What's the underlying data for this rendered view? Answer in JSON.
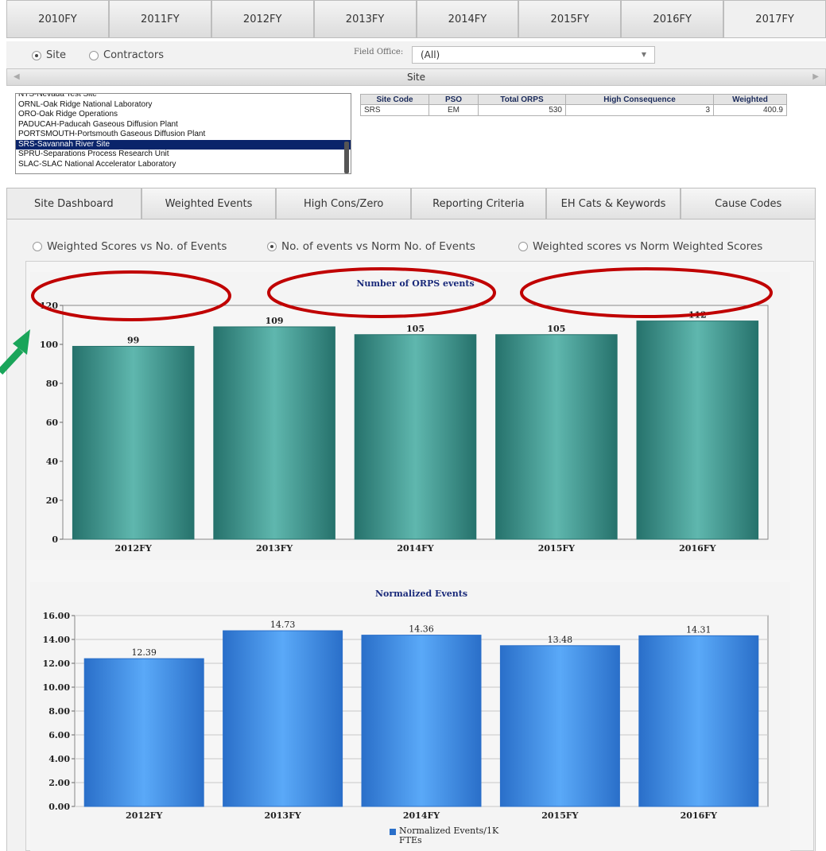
{
  "fy_tabs": [
    "2010FY",
    "2011FY",
    "2012FY",
    "2013FY",
    "2014FY",
    "2015FY",
    "2016FY",
    "2017FY"
  ],
  "filter": {
    "site_label": "Site",
    "contractors_label": "Contractors",
    "selected": "Site",
    "field_office_label": "Field Office:",
    "field_office_value": "(All)"
  },
  "site_bar_title": "Site",
  "site_list": [
    "NTS-Nevada Test Site",
    "ORNL-Oak Ridge National Laboratory",
    "ORO-Oak Ridge Operations",
    "PADUCAH-Paducah Gaseous Diffusion Plant",
    "PORTSMOUTH-Portsmouth Gaseous Diffusion Plant",
    "SRS-Savannah River Site",
    "SPRU-Separations Process Research Unit",
    "SLAC-SLAC National Accelerator Laboratory"
  ],
  "selected_site": "SRS-Savannah River Site",
  "summary": {
    "headers": [
      "Site Code",
      "PSO",
      "Total ORPS",
      "High Consequence",
      "Weighted"
    ],
    "row": [
      "SRS",
      "EM",
      "530",
      "3",
      "400.9"
    ]
  },
  "dash_tabs": [
    "Site Dashboard",
    "Weighted Events",
    "High Cons/Zero",
    "Reporting Criteria",
    "EH Cats & Keywords",
    "Cause Codes"
  ],
  "view_radios": {
    "options": [
      "Weighted Scores vs No. of Events",
      "No. of events vs Norm No. of Events",
      "Weighted scores vs Norm Weighted Scores"
    ],
    "selected": "No. of events vs Norm No. of Events"
  },
  "colors": {
    "teal_bar": "#2e8b85",
    "blue_bar": "#3d8ee6",
    "highlight_ellipse": "#c00000",
    "arrow": "#1aa55a",
    "selection": "#0a246a"
  },
  "chart_data": [
    {
      "type": "bar",
      "title": "Number of ORPS events",
      "categories": [
        "2012FY",
        "2013FY",
        "2014FY",
        "2015FY",
        "2016FY"
      ],
      "values": [
        99,
        109,
        105,
        105,
        112
      ],
      "value_labels": [
        "99",
        "109",
        "105",
        "105",
        "112"
      ],
      "ylim": [
        0,
        120
      ],
      "yticks": [
        "0",
        "20",
        "40",
        "60",
        "80",
        "100",
        "120"
      ],
      "grid": false,
      "xlabel": "",
      "ylabel": ""
    },
    {
      "type": "bar",
      "title": "Normalized Events",
      "categories": [
        "2012FY",
        "2013FY",
        "2014FY",
        "2015FY",
        "2016FY"
      ],
      "values": [
        12.39,
        14.73,
        14.36,
        13.48,
        14.31
      ],
      "value_labels": [
        "12.39",
        "14.73",
        "14.36",
        "13.48",
        "14.31"
      ],
      "ylim": [
        0,
        16
      ],
      "yticks": [
        "0.00",
        "2.00",
        "4.00",
        "6.00",
        "8.00",
        "10.00",
        "12.00",
        "14.00",
        "16.00"
      ],
      "grid": true,
      "legend": "Normalized Events/1K FTEs",
      "xlabel": "",
      "ylabel": ""
    }
  ]
}
